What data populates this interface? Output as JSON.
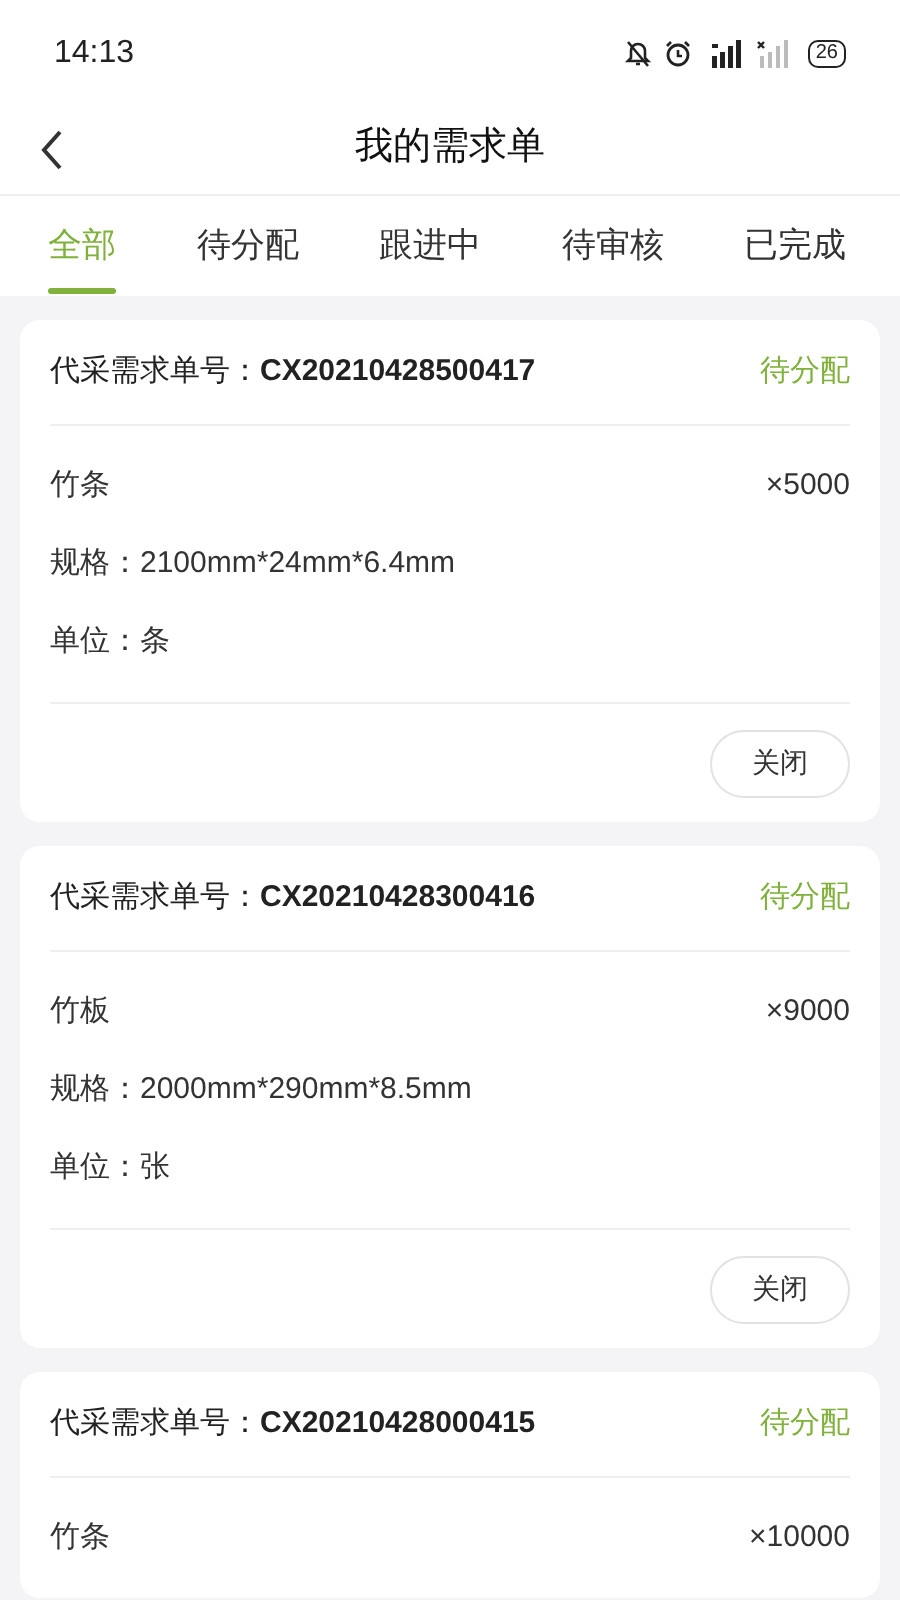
{
  "status_bar": {
    "time": "14:13",
    "battery": "26"
  },
  "header": {
    "title": "我的需求单"
  },
  "tabs": [
    {
      "label": "全部",
      "selected": true
    },
    {
      "label": "待分配",
      "selected": false
    },
    {
      "label": "跟进中",
      "selected": false
    },
    {
      "label": "待审核",
      "selected": false
    },
    {
      "label": "已完成",
      "selected": false
    }
  ],
  "orders": [
    {
      "number_label": "代采需求单号：",
      "number": "CX20210428500417",
      "status": "待分配",
      "item": "竹条",
      "quantity": "×5000",
      "spec": "规格：2100mm*24mm*6.4mm",
      "unit": "单位：条",
      "button": "关闭"
    },
    {
      "number_label": "代采需求单号：",
      "number": "CX20210428300416",
      "status": "待分配",
      "item": "竹板",
      "quantity": "×9000",
      "spec": "规格：2000mm*290mm*8.5mm",
      "unit": "单位：张",
      "button": "关闭"
    },
    {
      "number_label": "代采需求单号：",
      "number": "CX20210428000415",
      "status": "待分配",
      "item": "竹条",
      "quantity": "×10000"
    }
  ]
}
